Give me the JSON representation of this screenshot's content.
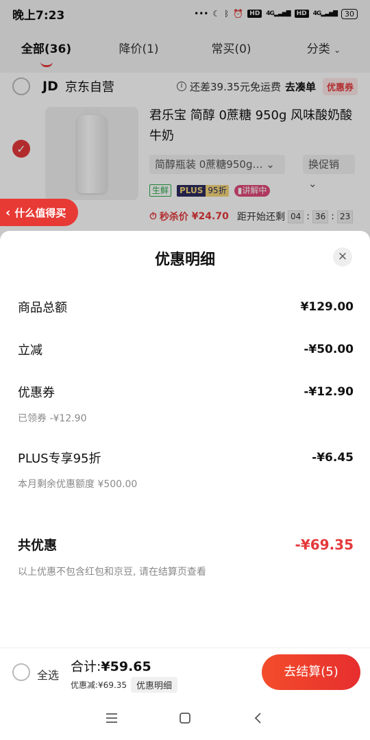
{
  "status_bar": {
    "time": "晚上7:23",
    "battery": "30",
    "network_labels": [
      "4G",
      "4G"
    ],
    "hd_labels": [
      "HD",
      "HD"
    ]
  },
  "tabs": [
    {
      "label": "全部(36)",
      "active": true
    },
    {
      "label": "降价(1)",
      "active": false
    },
    {
      "label": "常买(0)",
      "active": false
    },
    {
      "label": "分类",
      "active": false
    }
  ],
  "shop": {
    "logo": "JD",
    "name": "京东自营",
    "shipping_note": "还差39.35元免运费",
    "shipping_link": "去凑单",
    "coupon_chip": "优惠券"
  },
  "item": {
    "title": "君乐宝 简醇 0蔗糖 950g 风味酸奶酸牛奶",
    "sku": "简醇瓶装 0蔗糖950g…",
    "promo": "换促销",
    "tags": {
      "fresh": "生鲜",
      "plus": "PLUS",
      "plus_discount": "95折",
      "live": "讲解中"
    },
    "seckill_label": "秒杀价",
    "seckill_price": "¥24.70",
    "countdown_label": "距开始还剩",
    "countdown": [
      "04",
      "36",
      "23"
    ]
  },
  "floating_tab": {
    "label": "什么值得买"
  },
  "sheet": {
    "title": "优惠明细",
    "rows": [
      {
        "label": "商品总额",
        "amount": "¥129.00"
      },
      {
        "label": "立减",
        "amount": "-¥50.00"
      },
      {
        "label": "优惠券",
        "amount": "-¥12.90",
        "note": "已领券 -¥12.90"
      },
      {
        "label": "PLUS专享95折",
        "amount": "-¥6.45",
        "note": "本月剩余优惠额度 ¥500.00"
      }
    ],
    "total_label": "共优惠",
    "total_amount": "-¥69.35",
    "footer_note": "以上优惠不包含红包和京豆, 请在结算页查看"
  },
  "bottom_bar": {
    "select_all": "全选",
    "total_prefix": "合计:",
    "total_amount": "¥59.65",
    "discount_line": "优惠减:¥69.35",
    "detail_chip": "优惠明细",
    "checkout": "去结算(5)"
  },
  "colors": {
    "accent": "#e4393c",
    "checkout": "#f34d2b"
  }
}
